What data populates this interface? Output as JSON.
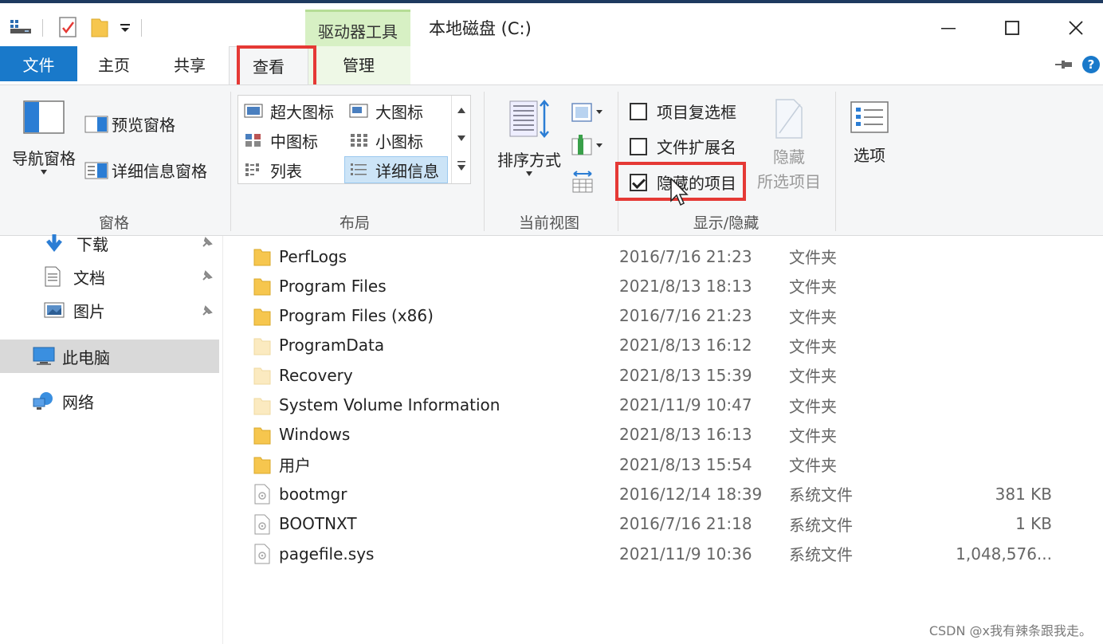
{
  "window": {
    "context_tab": "驱动器工具",
    "title": "本地磁盘 (C:)",
    "minimize_glyph": "—",
    "maximize_glyph": "☐",
    "close_glyph": "✕"
  },
  "tabs": {
    "file": "文件",
    "home": "主页",
    "share": "共享",
    "view": "查看",
    "manage": "管理"
  },
  "ribbon": {
    "panes": {
      "nav_pane": "导航窗格",
      "preview_pane": "预览窗格",
      "details_pane": "详细信息窗格",
      "group_label": "窗格"
    },
    "layout": {
      "items": [
        "超大图标",
        "大图标",
        "中图标",
        "小图标",
        "列表",
        "详细信息"
      ],
      "selected": "详细信息",
      "group_label": "布局"
    },
    "current_view": {
      "sort_by": "排序方式",
      "group_label": "当前视图"
    },
    "show_hide": {
      "item_checkboxes": {
        "label": "项目复选框",
        "checked": false
      },
      "file_extensions": {
        "label": "文件扩展名",
        "checked": false
      },
      "hidden_items": {
        "label": "隐藏的项目",
        "checked": true
      },
      "hide_selected_line1": "隐藏",
      "hide_selected_line2": "所选项目",
      "group_label": "显示/隐藏"
    },
    "options": "选项"
  },
  "nav": {
    "items": [
      {
        "label": "下载",
        "icon": "download-icon"
      },
      {
        "label": "文档",
        "icon": "document-icon"
      },
      {
        "label": "图片",
        "icon": "pictures-icon"
      },
      {
        "label": "此电脑",
        "icon": "this-pc-icon"
      },
      {
        "label": "网络",
        "icon": "network-icon"
      }
    ]
  },
  "files": [
    {
      "name": "PerfLogs",
      "date": "2016/7/16 21:23",
      "type": "文件夹",
      "size": "",
      "kind": "folder"
    },
    {
      "name": "Program Files",
      "date": "2021/8/13 18:13",
      "type": "文件夹",
      "size": "",
      "kind": "folder"
    },
    {
      "name": "Program Files (x86)",
      "date": "2016/7/16 21:23",
      "type": "文件夹",
      "size": "",
      "kind": "folder"
    },
    {
      "name": "ProgramData",
      "date": "2021/8/13 16:12",
      "type": "文件夹",
      "size": "",
      "kind": "hidden-folder"
    },
    {
      "name": "Recovery",
      "date": "2021/8/13 15:39",
      "type": "文件夹",
      "size": "",
      "kind": "hidden-folder"
    },
    {
      "name": "System Volume Information",
      "date": "2021/11/9 10:47",
      "type": "文件夹",
      "size": "",
      "kind": "hidden-folder"
    },
    {
      "name": "Windows",
      "date": "2021/8/13 16:13",
      "type": "文件夹",
      "size": "",
      "kind": "folder"
    },
    {
      "name": "用户",
      "date": "2021/8/13 15:54",
      "type": "文件夹",
      "size": "",
      "kind": "folder"
    },
    {
      "name": "bootmgr",
      "date": "2016/12/14 18:39",
      "type": "系统文件",
      "size": "381 KB",
      "kind": "system-file"
    },
    {
      "name": "BOOTNXT",
      "date": "2016/7/16 21:18",
      "type": "系统文件",
      "size": "1 KB",
      "kind": "system-file"
    },
    {
      "name": "pagefile.sys",
      "date": "2021/11/9 10:36",
      "type": "系统文件",
      "size": "1,048,576...",
      "kind": "system-file"
    }
  ],
  "watermark": "CSDN @x我有辣条跟我走。",
  "colors": {
    "file_tab": "#1979ca",
    "context_tab": "#d7f0c4",
    "highlight_box": "#e53935",
    "folder": "#f6c64e",
    "hidden_folder": "#fbeac0"
  }
}
